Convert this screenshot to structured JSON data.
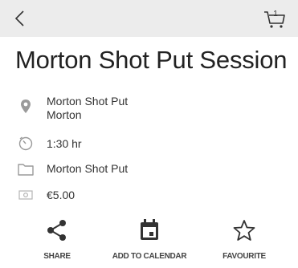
{
  "header": {
    "back_icon": "chevron-left-icon",
    "cart_icon": "cart-icon",
    "cart_count": "1"
  },
  "event": {
    "title": "Morton Shot Put Session",
    "location_name": "Morton Shot Put",
    "location_place": "Morton",
    "duration": "1:30 hr",
    "category": "Morton Shot Put",
    "price": "€5.00"
  },
  "actions": [
    {
      "label": "SHARE",
      "icon": "share-icon"
    },
    {
      "label": "ADD TO CALENDAR",
      "icon": "calendar-icon"
    },
    {
      "label": "FAVOURITE",
      "icon": "star-outline-icon"
    }
  ],
  "colors": {
    "topbar": "#ececec",
    "icon_gray": "#9a9a9a",
    "action_icon": "#333333"
  }
}
